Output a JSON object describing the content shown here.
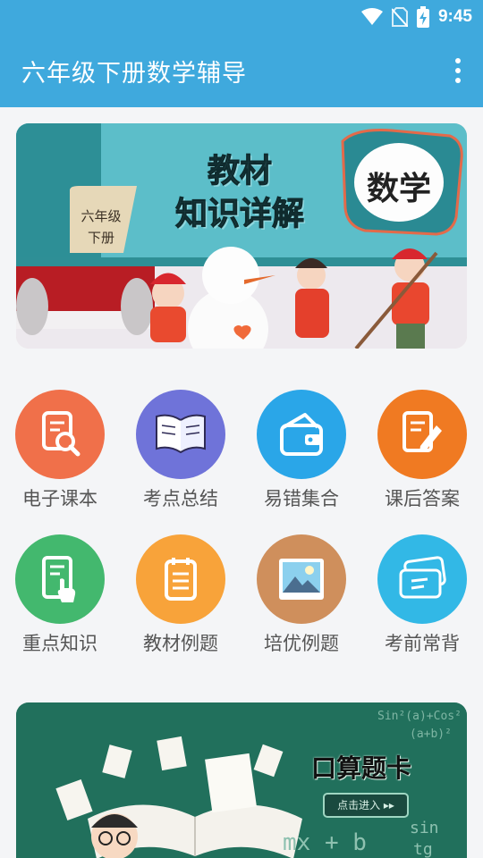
{
  "status": {
    "time": "9:45"
  },
  "app": {
    "title": "六年级下册数学辅导"
  },
  "banner": {
    "tag_line1": "六年级",
    "tag_line2": "下册",
    "heading_line1": "教材",
    "heading_line2": "知识详解",
    "subject_badge": "数学"
  },
  "features": [
    {
      "label": "电子课本",
      "color": "#f0704a",
      "icon": "textbook-search-icon"
    },
    {
      "label": "考点总结",
      "color": "#6f73d9",
      "icon": "open-book-icon"
    },
    {
      "label": "易错集合",
      "color": "#2aa6e8",
      "icon": "wallet-icon"
    },
    {
      "label": "课后答案",
      "color": "#f07a22",
      "icon": "document-pen-icon"
    },
    {
      "label": "重点知识",
      "color": "#43b86e",
      "icon": "tap-document-icon"
    },
    {
      "label": "教材例题",
      "color": "#f8a33a",
      "icon": "notepad-icon"
    },
    {
      "label": "培优例题",
      "color": "#cf8f5c",
      "icon": "picture-icon"
    },
    {
      "label": "考前常背",
      "color": "#32b8e6",
      "icon": "flashcards-icon"
    }
  ],
  "promo": {
    "title": "口算题卡",
    "button": "点击进入 ▸▸",
    "math_text": [
      "Sin²(a)+Cos²",
      "(a+b)²",
      "mx + b",
      "sin",
      "tg"
    ]
  }
}
